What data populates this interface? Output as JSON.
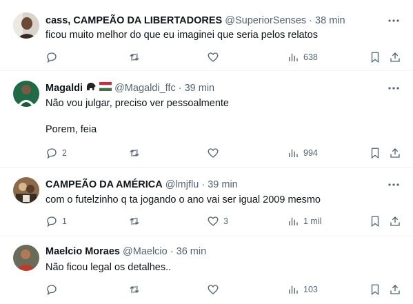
{
  "tweets": [
    {
      "name": "cass, CAMPEÃO DA LIBERTADORES",
      "handle": "@SuperiorSenses",
      "time": "38 min",
      "lines": [
        "ficou muito melhor do que eu imaginei que seria pelos relatos"
      ],
      "replies": "",
      "retweets": "",
      "likes": "",
      "views": "638"
    },
    {
      "name": "Magaldi",
      "handle": "@Magaldi_ffc",
      "time": "39 min",
      "lines": [
        "Não vou julgar, preciso ver pessoalmente",
        "",
        "Porem, feia"
      ],
      "replies": "2",
      "retweets": "",
      "likes": "",
      "views": "994"
    },
    {
      "name": "CAMPEÃO DA AMÉRICA",
      "handle": "@lmjflu",
      "time": "39 min",
      "lines": [
        "com o futelzinho q ta jogando o ano vai ser igual 2009 mesmo"
      ],
      "replies": "1",
      "retweets": "",
      "likes": "3",
      "views": "1 mil"
    },
    {
      "name": "Maelcio Moraes",
      "handle": "@Maelcio",
      "time": "36 min",
      "lines": [
        "Não ficou legal os detalhes.."
      ],
      "replies": "",
      "retweets": "",
      "likes": "",
      "views": "103"
    }
  ],
  "separator": "·",
  "icons": {
    "reply": "reply-icon",
    "retweet": "retweet-icon",
    "like": "like-icon",
    "views": "views-icon",
    "bookmark": "bookmark-icon",
    "share": "share-icon",
    "more": "more-icon",
    "gorilla_emoji": "gorilla-emoji-icon",
    "hungary_flag_emoji": "hungary-flag-icon"
  },
  "colors": {
    "text": "#0f1419",
    "secondary": "#536471",
    "divider": "#eff3f4"
  }
}
